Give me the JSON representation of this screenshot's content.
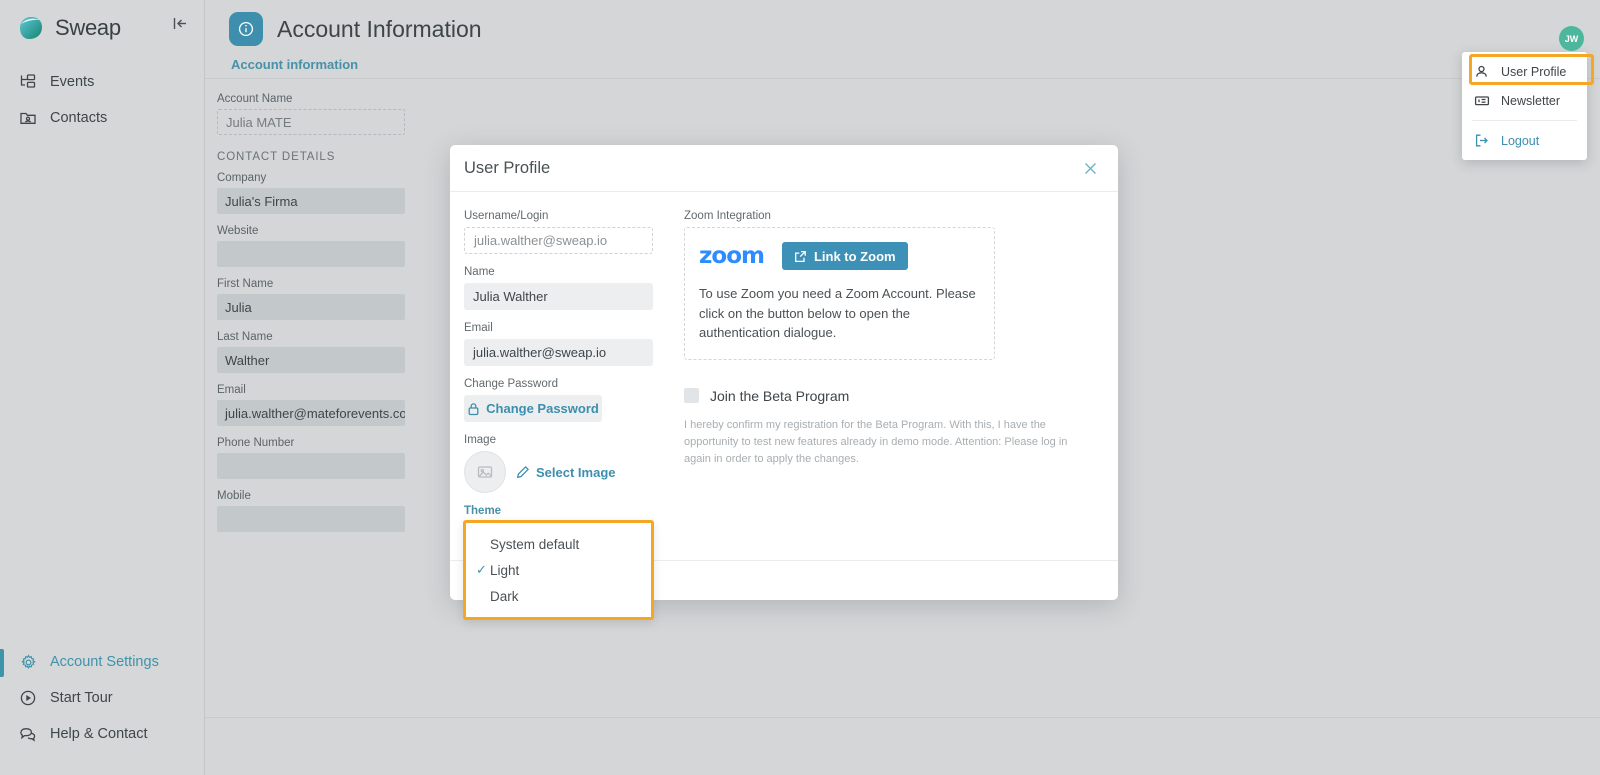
{
  "sidebar": {
    "brand": "Sweap",
    "collapse_icon": "collapse-panel-icon",
    "top_items": [
      {
        "label": "Events",
        "icon": "events-icon",
        "active": false
      },
      {
        "label": "Contacts",
        "icon": "contacts-icon",
        "active": false
      }
    ],
    "bottom_items": [
      {
        "label": "Account Settings",
        "icon": "gear-icon",
        "active": true
      },
      {
        "label": "Start Tour",
        "icon": "play-circle-icon",
        "active": false
      },
      {
        "label": "Help & Contact",
        "icon": "chat-icon",
        "active": false
      }
    ]
  },
  "header": {
    "title": "Account Information",
    "badge_icon": "info-icon",
    "tab": "Account information"
  },
  "account_form": {
    "account_name": {
      "label": "Account Name",
      "value": "Julia MATE"
    },
    "section_title": "CONTACT DETAILS",
    "fields": [
      {
        "label": "Company",
        "value": "Julia's Firma"
      },
      {
        "label": "Website",
        "value": ""
      },
      {
        "label": "First Name",
        "value": "Julia"
      },
      {
        "label": "Last Name",
        "value": "Walther"
      },
      {
        "label": "Email",
        "value": "julia.walther@mateforevents.com"
      },
      {
        "label": "Phone Number",
        "value": ""
      },
      {
        "label": "Mobile",
        "value": ""
      }
    ]
  },
  "modal": {
    "title": "User Profile",
    "close_icon": "close-icon",
    "left": {
      "username": {
        "label": "Username/Login",
        "value": "julia.walther@sweap.io"
      },
      "name": {
        "label": "Name",
        "value": "Julia Walther"
      },
      "email": {
        "label": "Email",
        "value": "julia.walther@sweap.io"
      },
      "change_password": {
        "label": "Change Password",
        "button": "Change Password",
        "icon": "lock-icon"
      },
      "image": {
        "label": "Image",
        "button": "Select Image",
        "icon": "pencil-icon",
        "placeholder_icon": "image-icon"
      },
      "theme": {
        "label": "Theme",
        "selected": "Light",
        "options": [
          "System default",
          "Light",
          "Dark"
        ],
        "check_glyph": "✓",
        "highlight_color": "#f5a623"
      }
    },
    "right": {
      "zoom_label": "Zoom Integration",
      "zoom_logo": "zoom",
      "zoom_button": "Link to Zoom",
      "zoom_button_icon": "external-link-icon",
      "zoom_description": "To use Zoom you need a Zoom Account. Please click on the button below to open the authentication dialogue.",
      "beta_label": "Join the Beta Program",
      "beta_description": "I hereby confirm my registration for the Beta Program. With this, I have the opportunity to test new features already in demo mode. Attention: Please log in again in order to apply the changes."
    }
  },
  "user_menu": {
    "avatar_initials": "JW",
    "avatar_color": "#4cb79c",
    "items": [
      {
        "label": "User Profile",
        "icon": "person-icon",
        "highlighted": true
      },
      {
        "label": "Newsletter",
        "icon": "newsletter-icon",
        "highlighted": false
      },
      {
        "label": "Logout",
        "icon": "logout-icon",
        "highlighted": false
      }
    ]
  },
  "accents": {
    "teal": "#3d8fad",
    "orange_highlight": "#f5a623",
    "zoom_blue": "#2d8cff"
  }
}
